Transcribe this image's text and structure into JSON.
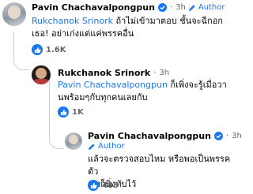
{
  "comments": [
    {
      "author": "Pavin Chachavalpongpun",
      "time": "3h",
      "badge": "Author",
      "mention": "Rukchanok Srinork",
      "text_after_mention": " ถ้าไม่เข้ามาตอบ ชั้นจะฉีกอก",
      "text_line2": "เธอ! อย่าเก่งแต่แค่พรรคอื่น",
      "likes": "1.6K"
    },
    {
      "author": "Rukchanok Srinork",
      "time": "3h",
      "mention": "Pavin Chachavalpongpun",
      "text_after_mention": " ก็เพิ่งจะรู้เมื่อวา",
      "text_line2": "นพร้อมๆกับทุกคนเลยกับ",
      "likes": "1K"
    },
    {
      "author": "Pavin Chachavalpongpun",
      "time": "3h",
      "badge": "Author",
      "text_line1": "แล้วจะตรวจสอบไหม หรือพอเป็นพรรคตัว",
      "text_line2": "เองก็นิ่งทับไว้",
      "likes": "488"
    }
  ],
  "colors": {
    "link": "#1877f2",
    "muted": "#65676b",
    "text": "#050505"
  },
  "icons": {
    "verified": "verified-badge-icon",
    "like": "thumbs-up-icon",
    "author": "pencil-icon"
  }
}
